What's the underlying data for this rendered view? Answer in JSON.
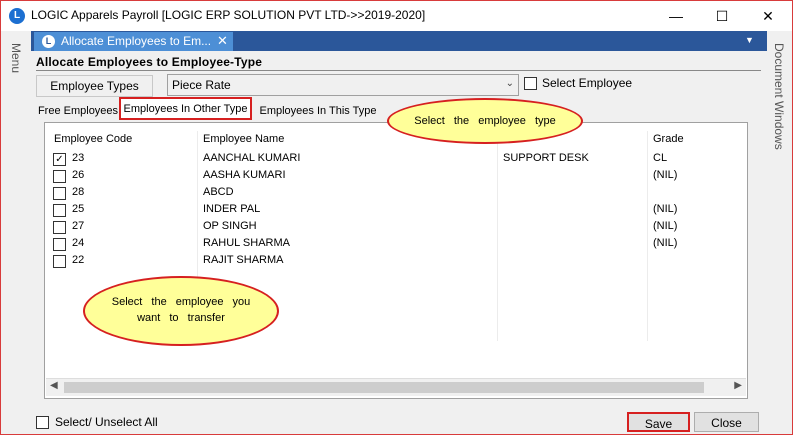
{
  "app": {
    "title": "LOGIC Apparels Payroll  [LOGIC ERP SOLUTION PVT LTD->>2019-2020]",
    "icon_letter": "L",
    "minimize": "—",
    "maximize": "☐",
    "close": "✕"
  },
  "side": {
    "menu_label": "Menu",
    "doc_label": "Document Windows"
  },
  "doc_tab": {
    "label": "Allocate Employees to Em...",
    "close": "✕",
    "dropdown": "▼"
  },
  "form": {
    "title": "Allocate Employees to Employee-Type",
    "emp_types_label": "Employee Types",
    "emp_type_value": "Piece Rate",
    "select_employee_label": "Select Employee",
    "select_employee_checked": false
  },
  "subtabs": {
    "free": "Free Employees",
    "other": "Employees In Other Type",
    "this": "Employees In This Type",
    "active": "other"
  },
  "grid": {
    "headers": [
      "Employee Code",
      "Employee Name",
      "",
      "Grade"
    ],
    "rows": [
      {
        "checked": true,
        "code": "23",
        "name": "AANCHAL KUMARI",
        "dept": "SUPPORT DESK",
        "grade": "CL"
      },
      {
        "checked": false,
        "code": "26",
        "name": "AASHA KUMARI",
        "dept": "",
        "grade": "(NIL)"
      },
      {
        "checked": false,
        "code": "28",
        "name": "ABCD",
        "dept": "",
        "grade": ""
      },
      {
        "checked": false,
        "code": "25",
        "name": "INDER PAL",
        "dept": "",
        "grade": "(NIL)"
      },
      {
        "checked": false,
        "code": "27",
        "name": "OP SINGH",
        "dept": "",
        "grade": "(NIL)"
      },
      {
        "checked": false,
        "code": "24",
        "name": "RAHUL SHARMA",
        "dept": "",
        "grade": "(NIL)"
      },
      {
        "checked": false,
        "code": "22",
        "name": "RAJIT SHARMA",
        "dept": "",
        "grade": ""
      }
    ],
    "scroll_left": "◀",
    "scroll_right": "▶"
  },
  "footer": {
    "select_all_label": "Select/ Unselect All",
    "save_label": "Save",
    "close_label": "Close"
  },
  "callouts": {
    "type_hint": "Select the employee type",
    "employee_hint": "Select the employee you want to transfer"
  },
  "colors": {
    "tab_strip": "#2b579a",
    "active_doc_tab": "#4d8fd6",
    "highlight_border": "#d62020",
    "callout_fill": "#ffff99"
  }
}
